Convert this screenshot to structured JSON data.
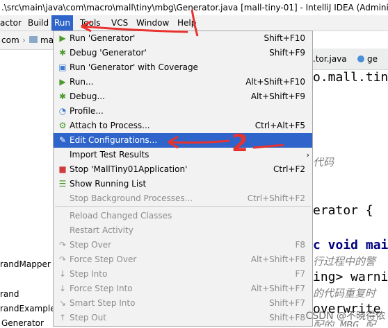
{
  "title": ".\\src\\main\\java\\com\\macro\\mall\\tiny\\mbg\\Generator.java [mall-tiny-01] - IntelliJ IDEA (Adminis",
  "menubar": [
    "actor",
    "Build",
    "Run",
    "Tools",
    "VCS",
    "Window",
    "Help"
  ],
  "navbar_text": "com",
  "navbar_folder_text": "ma",
  "left_panel_items": [
    "randMapper",
    "rand",
    "randExample",
    "Generator"
  ],
  "editor_tabs": [
    ".tor.java",
    "ge"
  ],
  "editor_lines": [
    "o.mall.tin",
    "代码",
    "erator {",
    "c void mai",
    "行过程中的警",
    "ing> warni",
    "的代码重复时",
    "overwrite",
    "配的 MBG 配"
  ],
  "menu": [
    {
      "icon": "play-icon",
      "label": "Run 'Generator'",
      "shortcut": "Shift+F10",
      "state": "normal"
    },
    {
      "icon": "bug-icon",
      "label": "Debug 'Generator'",
      "shortcut": "Shift+F9",
      "state": "normal"
    },
    {
      "icon": "coverage-icon",
      "label": "Run 'Generator' with Coverage",
      "shortcut": "",
      "state": "normal"
    },
    {
      "icon": "play-icon",
      "label": "Run...",
      "shortcut": "Alt+Shift+F10",
      "state": "normal"
    },
    {
      "icon": "bug-icon",
      "label": "Debug...",
      "shortcut": "Alt+Shift+F9",
      "state": "normal"
    },
    {
      "icon": "profile-icon",
      "label": "Profile...",
      "shortcut": "",
      "state": "normal"
    },
    {
      "icon": "attach-icon",
      "label": "Attach to Process...",
      "shortcut": "Ctrl+Alt+F5",
      "state": "normal"
    },
    {
      "icon": "edit-config-icon",
      "label": "Edit Configurations...",
      "shortcut": "",
      "state": "selected"
    },
    {
      "icon": "",
      "label": "Import Test Results",
      "shortcut": "",
      "state": "submenu"
    },
    {
      "icon": "stop-icon",
      "label": "Stop 'MallTiny01Application'",
      "shortcut": "Ctrl+F2",
      "state": "normal"
    },
    {
      "icon": "list-icon",
      "label": "Show Running List",
      "shortcut": "",
      "state": "normal"
    },
    {
      "icon": "",
      "label": "Stop Background Processes...",
      "shortcut": "Ctrl+Shift+F2",
      "state": "disabled"
    },
    {
      "icon": "",
      "label": "Reload Changed Classes",
      "shortcut": "",
      "state": "disabled"
    },
    {
      "icon": "",
      "label": "Restart Activity",
      "shortcut": "",
      "state": "disabled"
    },
    {
      "icon": "step-over-icon",
      "label": "Step Over",
      "shortcut": "F8",
      "state": "disabled"
    },
    {
      "icon": "force-step-over-icon",
      "label": "Force Step Over",
      "shortcut": "Alt+Shift+F8",
      "state": "disabled"
    },
    {
      "icon": "step-into-icon",
      "label": "Step Into",
      "shortcut": "F7",
      "state": "disabled"
    },
    {
      "icon": "force-step-into-icon",
      "label": "Force Step Into",
      "shortcut": "Alt+Shift+F7",
      "state": "disabled"
    },
    {
      "icon": "smart-step-into-icon",
      "label": "Smart Step Into",
      "shortcut": "Shift+F7",
      "state": "disabled"
    },
    {
      "icon": "step-out-icon",
      "label": "Step Out",
      "shortcut": "Shift+F8",
      "state": "disabled"
    }
  ],
  "annotation_numbers": [
    "1",
    "2"
  ],
  "watermark": "CSDN @不晓得侬",
  "colors": {
    "selection": "#2f65ca",
    "annotation": "#e8322f",
    "menu_bg": "#f2f2f2"
  }
}
